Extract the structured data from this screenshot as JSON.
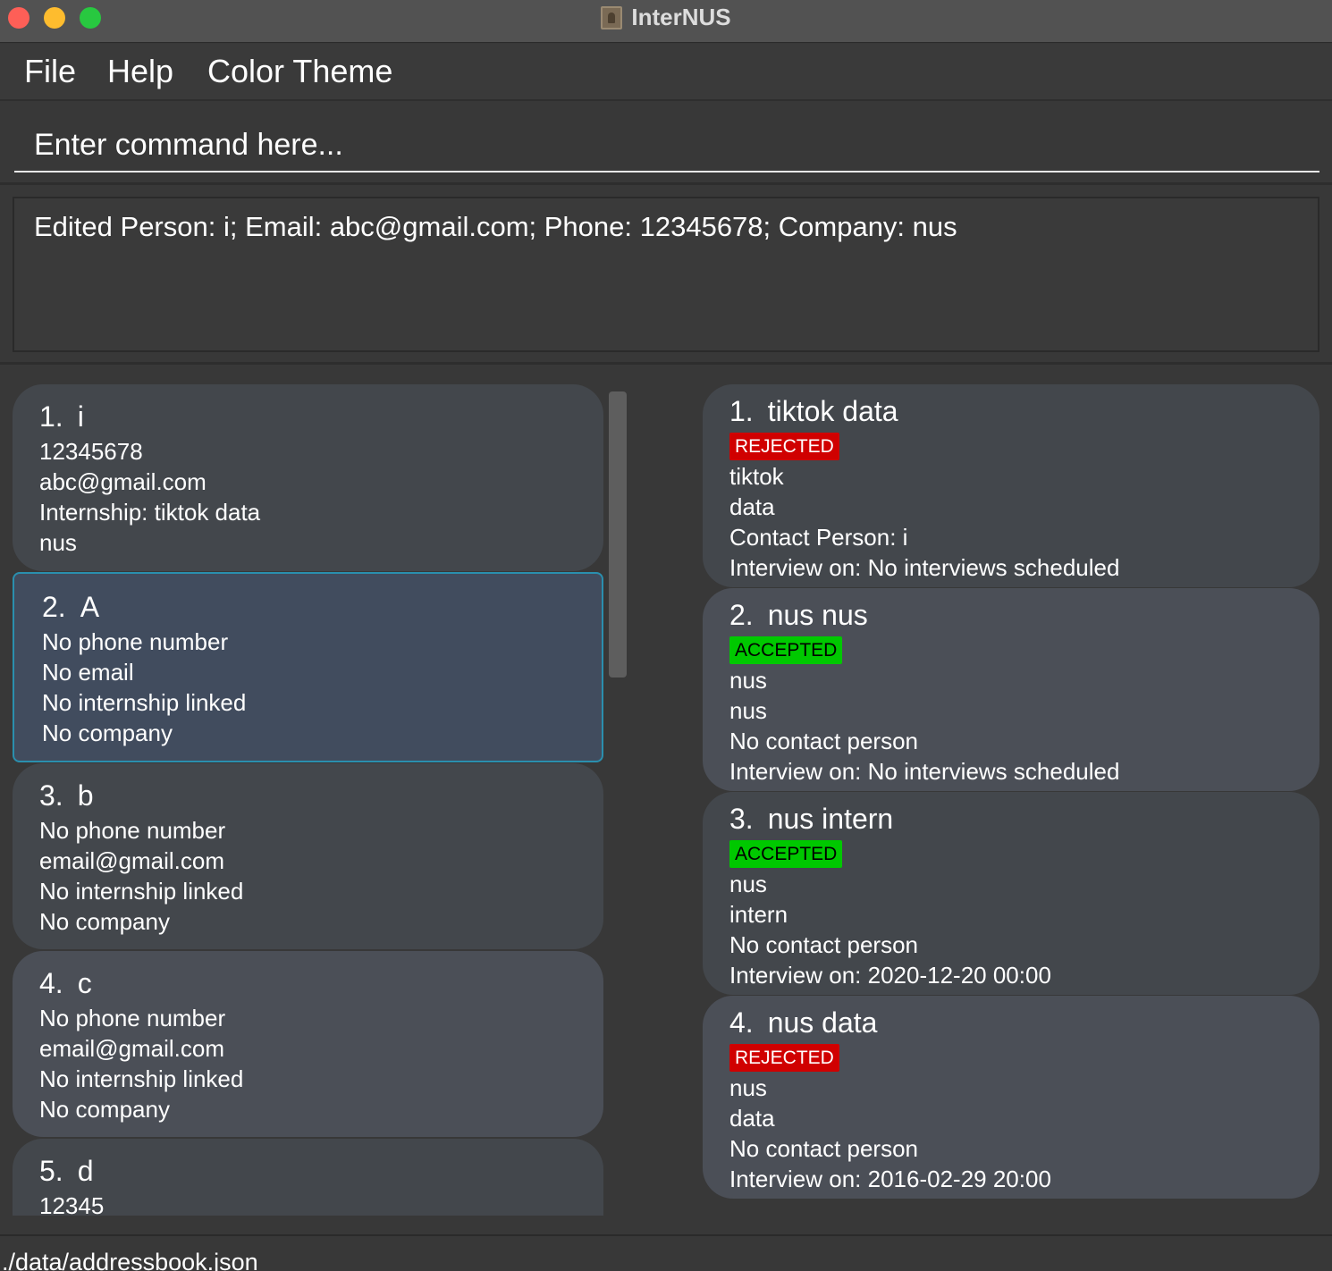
{
  "window": {
    "title": "InterNUS"
  },
  "menu": {
    "file": "File",
    "help": "Help",
    "color_theme": "Color Theme"
  },
  "command": {
    "placeholder": "Enter command here..."
  },
  "result": {
    "text": "Edited Person: i; Email: abc@gmail.com; Phone: 12345678; Company: nus"
  },
  "persons": [
    {
      "index": "1.",
      "name": "i",
      "phone": "12345678",
      "email": "abc@gmail.com",
      "internship": "Internship: tiktok data",
      "company": "nus"
    },
    {
      "index": "2.",
      "name": "A",
      "phone": "No phone number",
      "email": "No email",
      "internship": "No internship linked",
      "company": "No company"
    },
    {
      "index": "3.",
      "name": "b",
      "phone": "No phone number",
      "email": "email@gmail.com",
      "internship": "No internship linked",
      "company": "No company"
    },
    {
      "index": "4.",
      "name": "c",
      "phone": "No phone number",
      "email": "email@gmail.com",
      "internship": "No internship linked",
      "company": "No company"
    },
    {
      "index": "5.",
      "name": "d",
      "phone": "12345"
    }
  ],
  "internships": [
    {
      "index": "1.",
      "title": "tiktok data",
      "status": "REJECTED",
      "company": "tiktok",
      "role": "data",
      "contact": "Contact Person: i",
      "interview": "Interview on: No interviews scheduled"
    },
    {
      "index": "2.",
      "title": "nus nus",
      "status": "ACCEPTED",
      "company": "nus",
      "role": "nus",
      "contact": "No contact person",
      "interview": "Interview on: No interviews scheduled"
    },
    {
      "index": "3.",
      "title": "nus intern",
      "status": "ACCEPTED",
      "company": "nus",
      "role": "intern",
      "contact": "No contact person",
      "interview": "Interview on: 2020-12-20 00:00"
    },
    {
      "index": "4.",
      "title": "nus data",
      "status": "REJECTED",
      "company": "nus",
      "role": "data",
      "contact": "No contact person",
      "interview": "Interview on: 2016-02-29 20:00"
    }
  ],
  "status_bar": {
    "path": "./data/addressbook.json"
  },
  "colors": {
    "rejected": "#d00000",
    "accepted": "#00c800",
    "selection_border": "#2a8fae"
  }
}
